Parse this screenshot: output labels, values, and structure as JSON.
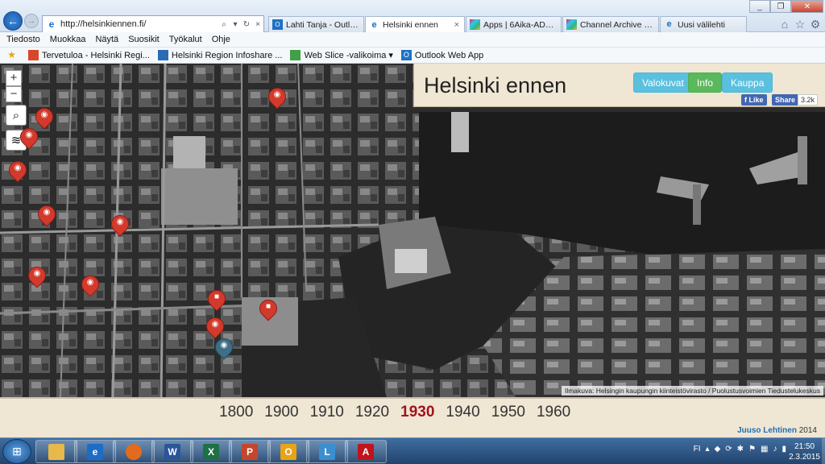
{
  "browser": {
    "url": "http://helsinkiennen.fi/",
    "tabs": [
      {
        "label": "Lahti Tanja - Outlook W...",
        "icon": "outlook-icon",
        "active": false
      },
      {
        "label": "Helsinki ennen",
        "icon": "ie-page-icon",
        "active": true,
        "close": "×"
      },
      {
        "label": "Apps | 6Aika-AD Slack",
        "icon": "slack-icon",
        "active": false
      },
      {
        "label": "Channel Archive (#tapa...",
        "icon": "slack-icon",
        "active": false
      },
      {
        "label": "Uusi välilehti",
        "icon": "ie-page-icon",
        "active": false
      }
    ],
    "menu": [
      "Tiedosto",
      "Muokkaa",
      "Näytä",
      "Suosikit",
      "Työkalut",
      "Ohje"
    ],
    "favorites": [
      {
        "label": "Tervetuloa - Helsinki Regi...",
        "icon": "favorite-page-icon"
      },
      {
        "label": "Helsinki Region Infoshare ...",
        "icon": "favorite-page-icon"
      },
      {
        "label": "Web Slice -valikoima",
        "icon": "web-slice-icon",
        "dropdown": "▾"
      },
      {
        "label": "Outlook Web App",
        "icon": "outlook-icon"
      }
    ]
  },
  "site": {
    "title": "Helsinki ennen",
    "buttons": {
      "photos": "Valokuvat",
      "info": "Info",
      "shop": "Kauppa"
    },
    "facebook": {
      "like": "Like",
      "share": "Share",
      "count": "3.2k"
    }
  },
  "map": {
    "zoom_in": "+",
    "zoom_out": "−",
    "credit": "Ilmakuva: Helsingin kaupungin kiinteistövirasto / Puolustusvoimien Tiedustelukeskus",
    "markers": [
      {
        "type": "photo",
        "color": "#d33a2c"
      },
      {
        "type": "photo",
        "color": "#d33a2c"
      },
      {
        "type": "photo",
        "color": "#d33a2c"
      },
      {
        "type": "photo",
        "color": "#d33a2c"
      },
      {
        "type": "photo",
        "color": "#d33a2c"
      },
      {
        "type": "photo",
        "color": "#d33a2c"
      },
      {
        "type": "photo",
        "color": "#d33a2c"
      },
      {
        "type": "photo",
        "color": "#d33a2c"
      },
      {
        "type": "video",
        "color": "#d33a2c"
      },
      {
        "type": "video",
        "color": "#d33a2c"
      },
      {
        "type": "photo",
        "color": "#d33a2c"
      },
      {
        "type": "photo",
        "color": "#3f6f86"
      }
    ]
  },
  "timeline": {
    "years": [
      "1800",
      "1900",
      "1910",
      "1920",
      "1930",
      "1940",
      "1950",
      "1960"
    ],
    "selected": "1930",
    "author_name": "Juuso Lehtinen",
    "author_year": "2014"
  },
  "taskbar": {
    "apps": [
      {
        "name": "explorer",
        "label": "",
        "color": "#e8b84a"
      },
      {
        "name": "internet-explorer",
        "label": "e",
        "color": "#1d6cc8"
      },
      {
        "name": "firefox",
        "label": "",
        "color": "#e36b1e"
      },
      {
        "name": "word",
        "label": "W",
        "color": "#2a5699"
      },
      {
        "name": "excel",
        "label": "X",
        "color": "#1e7145"
      },
      {
        "name": "powerpoint",
        "label": "P",
        "color": "#c6462b"
      },
      {
        "name": "outlook",
        "label": "O",
        "color": "#e8a317"
      },
      {
        "name": "lync",
        "label": "L",
        "color": "#3b8fd1"
      },
      {
        "name": "acrobat",
        "label": "A",
        "color": "#c0141a"
      }
    ],
    "language": "FI",
    "time": "21:50",
    "date": "2.3.2015"
  }
}
